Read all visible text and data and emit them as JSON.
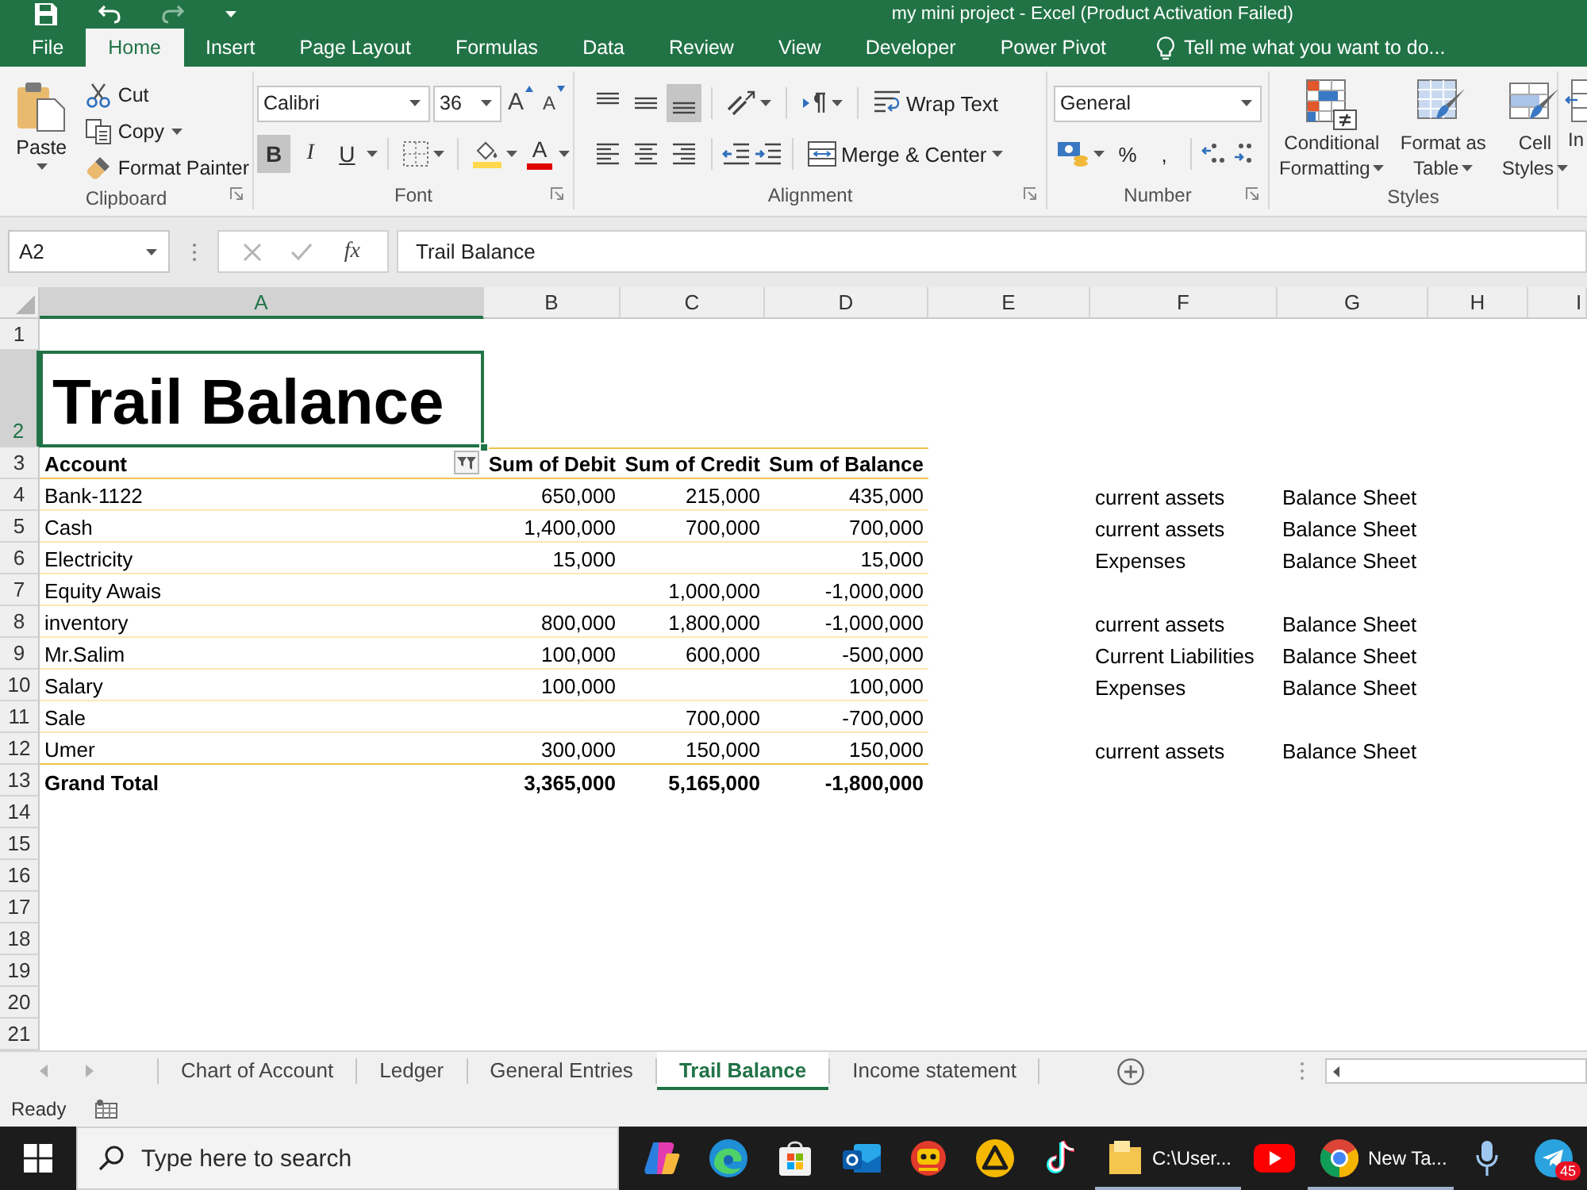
{
  "window": {
    "title": "my mini project - Excel (Product Activation Failed)"
  },
  "ribbon": {
    "tabs": [
      {
        "label": "File",
        "selected": false
      },
      {
        "label": "Home",
        "selected": true
      },
      {
        "label": "Insert",
        "selected": false
      },
      {
        "label": "Page Layout",
        "selected": false
      },
      {
        "label": "Formulas",
        "selected": false
      },
      {
        "label": "Data",
        "selected": false
      },
      {
        "label": "Review",
        "selected": false
      },
      {
        "label": "View",
        "selected": false
      },
      {
        "label": "Developer",
        "selected": false
      },
      {
        "label": "Power Pivot",
        "selected": false
      }
    ],
    "tell_me": "Tell me what you want to do...",
    "clipboard": {
      "label": "Clipboard",
      "paste": "Paste",
      "cut": "Cut",
      "copy": "Copy",
      "format_painter": "Format Painter"
    },
    "font": {
      "label": "Font",
      "name": "Calibri",
      "size": "36",
      "grow": "A",
      "shrink": "A",
      "styles": [
        {
          "kind": "bold",
          "label": "B",
          "selected": true
        },
        {
          "kind": "italic",
          "label": "I",
          "selected": false
        },
        {
          "kind": "underline",
          "label": "U",
          "selected": false
        }
      ],
      "font_color": "A"
    },
    "alignment": {
      "label": "Alignment",
      "vertical": [
        {
          "kind": "top",
          "selected": false
        },
        {
          "kind": "middle",
          "selected": false
        },
        {
          "kind": "bottom",
          "selected": true
        }
      ],
      "horizontal": [
        {
          "kind": "left",
          "selected": false
        },
        {
          "kind": "center",
          "selected": false
        },
        {
          "kind": "right",
          "selected": false
        }
      ],
      "wrap_text": "Wrap Text",
      "merge_center": "Merge & Center"
    },
    "number": {
      "label": "Number",
      "format": "General",
      "percent": "%",
      "comma": ","
    },
    "styles": {
      "label": "Styles",
      "buttons": [
        {
          "kind": "conditional",
          "lines": [
            "Conditional",
            "Formatting"
          ]
        },
        {
          "kind": "table",
          "lines": [
            "Format as",
            "Table"
          ]
        },
        {
          "kind": "cell",
          "lines": [
            "Cell",
            "Styles"
          ]
        }
      ]
    },
    "cells": {
      "insert": "In"
    }
  },
  "formula_bar": {
    "name_box": "A2",
    "function_label": "fx",
    "value": "Trail Balance"
  },
  "sheet": {
    "columns": [
      {
        "label": "A",
        "selected": true
      },
      {
        "label": "B",
        "selected": false
      },
      {
        "label": "C",
        "selected": false
      },
      {
        "label": "D",
        "selected": false
      },
      {
        "label": "E",
        "selected": false
      },
      {
        "label": "F",
        "selected": false
      },
      {
        "label": "G",
        "selected": false
      },
      {
        "label": "H",
        "selected": false
      },
      {
        "label": "I",
        "selected": false
      }
    ],
    "rows": [
      {
        "label": "1",
        "selected": false
      },
      {
        "label": "2",
        "selected": true
      },
      {
        "label": "3",
        "selected": false
      },
      {
        "label": "4",
        "selected": false
      },
      {
        "label": "5",
        "selected": false
      },
      {
        "label": "6",
        "selected": false
      },
      {
        "label": "7",
        "selected": false
      },
      {
        "label": "8",
        "selected": false
      },
      {
        "label": "9",
        "selected": false
      },
      {
        "label": "10",
        "selected": false
      },
      {
        "label": "11",
        "selected": false
      },
      {
        "label": "12",
        "selected": false
      },
      {
        "label": "13",
        "selected": false
      },
      {
        "label": "14",
        "selected": false
      },
      {
        "label": "15",
        "selected": false
      },
      {
        "label": "16",
        "selected": false
      },
      {
        "label": "17",
        "selected": false
      },
      {
        "label": "18",
        "selected": false
      },
      {
        "label": "19",
        "selected": false
      },
      {
        "label": "20",
        "selected": false
      },
      {
        "label": "21",
        "selected": false
      }
    ],
    "title": "Trail Balance",
    "pivot": {
      "headers": [
        "Account",
        "Sum of Debit",
        "Sum of Credit",
        "Sum of Balance"
      ],
      "rows": [
        {
          "account": "Bank-1122",
          "debit": "650,000",
          "credit": "215,000",
          "balance": "435,000",
          "category": "current assets",
          "statement": "Balance Sheet"
        },
        {
          "account": "Cash",
          "debit": "1,400,000",
          "credit": "700,000",
          "balance": "700,000",
          "category": "current assets",
          "statement": "Balance Sheet"
        },
        {
          "account": "Electricity",
          "debit": "15,000",
          "balance": "15,000",
          "category": "Expenses",
          "statement": "Balance Sheet"
        },
        {
          "account": "Equity Awais",
          "credit": "1,000,000",
          "balance": "-1,000,000"
        },
        {
          "account": "inventory",
          "debit": "800,000",
          "credit": "1,800,000",
          "balance": "-1,000,000",
          "category": "current assets",
          "statement": "Balance Sheet"
        },
        {
          "account": "Mr.Salim",
          "debit": "100,000",
          "credit": "600,000",
          "balance": "-500,000",
          "category": "Current Liabilities",
          "statement": "Balance Sheet"
        },
        {
          "account": "Salary",
          "debit": "100,000",
          "balance": "100,000",
          "category": "Expenses",
          "statement": "Balance Sheet"
        },
        {
          "account": "Sale",
          "credit": "700,000",
          "balance": "-700,000"
        },
        {
          "account": "Umer",
          "debit": "300,000",
          "credit": "150,000",
          "balance": "150,000",
          "category": "current assets",
          "statement": "Balance Sheet"
        }
      ],
      "total": {
        "account": "Grand Total",
        "debit": "3,365,000",
        "credit": "5,165,000",
        "balance": "-1,800,000"
      }
    }
  },
  "sheet_tabs": [
    {
      "label": "Chart of Account",
      "selected": false
    },
    {
      "label": "Ledger",
      "selected": false
    },
    {
      "label": "General Entries",
      "selected": false
    },
    {
      "label": "Trail Balance",
      "selected": true
    },
    {
      "label": "Income statement",
      "selected": false
    }
  ],
  "status_bar": {
    "text": "Ready"
  },
  "taskbar": {
    "search_placeholder": "Type here to search",
    "apps": [
      {
        "kind": "copilot",
        "open": false
      },
      {
        "kind": "edge",
        "open": false
      },
      {
        "kind": "store",
        "open": false
      },
      {
        "kind": "outlook",
        "open": false
      },
      {
        "kind": "game",
        "open": false
      },
      {
        "kind": "triangle",
        "open": false
      },
      {
        "kind": "tiktok",
        "open": false
      },
      {
        "kind": "explorer",
        "label": "C:\\User...",
        "open": true
      },
      {
        "kind": "youtube",
        "open": false
      },
      {
        "kind": "chrome",
        "label": "New Ta...",
        "open": true
      },
      {
        "kind": "microphone",
        "open": false
      },
      {
        "kind": "telegram",
        "badge": "45",
        "open": false
      }
    ]
  }
}
